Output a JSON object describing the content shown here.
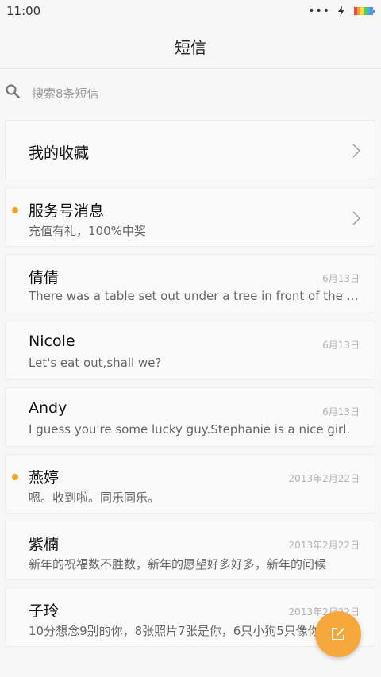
{
  "status": {
    "time": "11:00",
    "icons": [
      "more-dots-icon",
      "charging-bolt-icon",
      "battery-icon"
    ]
  },
  "header": {
    "title": "短信"
  },
  "search": {
    "placeholder": "搜索8条短信"
  },
  "favorites": {
    "label": "我的收藏"
  },
  "service": {
    "name": "服务号消息",
    "preview": "充值有礼，100%中奖",
    "unread": true
  },
  "threads": [
    {
      "name": "倩倩",
      "preview": "There was a table set out under a tree in front of the house",
      "date": "6月13日",
      "unread": false
    },
    {
      "name": "Nicole",
      "preview": "Let's eat out,shall we?",
      "date": "6月13日",
      "unread": false
    },
    {
      "name": "Andy",
      "preview": "I guess you're some lucky guy.Stephanie is a nice girl.",
      "date": "6月13日",
      "unread": false
    },
    {
      "name": "燕婷",
      "preview": "嗯。收到啦。同乐同乐。",
      "date": "2013年2月22日",
      "unread": true
    },
    {
      "name": "紫楠",
      "preview": "新年的祝福数不胜数，新年的愿望好多好多，新年的问候",
      "date": "2013年2月22日",
      "unread": false
    },
    {
      "name": "子玲",
      "preview": "10分想念9别的你，8张照片7张是你，6只小狗5只像你",
      "date": "2013年2月22日",
      "unread": false
    }
  ],
  "fab": {
    "icon": "compose-icon"
  },
  "colors": {
    "accent": "#f5a93a",
    "unread_dot": "#f5a623",
    "background": "#f7f7f7"
  }
}
